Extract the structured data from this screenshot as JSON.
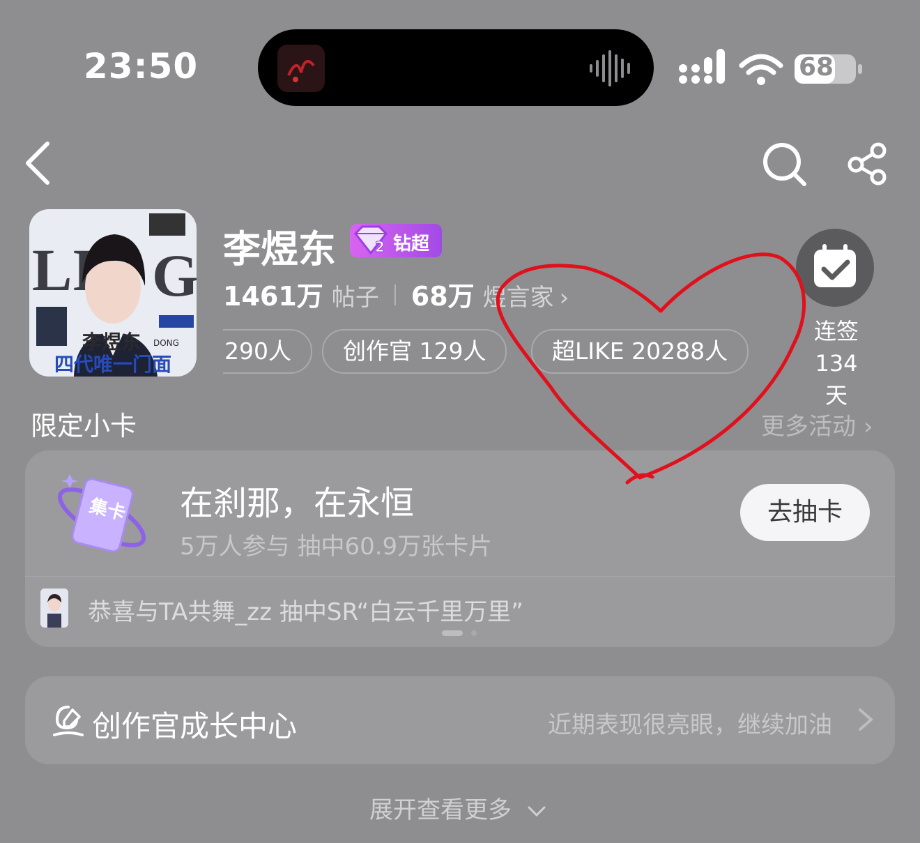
{
  "status": {
    "time": "23:50",
    "battery": "68"
  },
  "profile": {
    "name": "李煜东",
    "badge": "钻超",
    "avatar_text": {
      "name": "李煜东",
      "slogan": "四代唯一门面",
      "tag": "DONG"
    },
    "stats": [
      {
        "value": "1461万",
        "label": "帖子"
      },
      {
        "value": "68万",
        "label": "煜言家"
      }
    ],
    "pills": [
      "290人",
      "创作官 129人",
      "超LIKE 20288人"
    ],
    "checkin": {
      "line1": "连签134",
      "line2": "天"
    }
  },
  "section": {
    "title": "限定小卡",
    "more": "更多活动"
  },
  "card": {
    "icon_text": "集卡",
    "title": "在刹那，在永恒",
    "subtitle": "5万人参与 抽中60.9万张卡片",
    "button": "去抽卡",
    "news": "恭喜与TA共舞_zz 抽中SR“白云千里万里”"
  },
  "growth": {
    "title": "创作官成长中心",
    "note": "近期表现很亮眼，继续加油"
  },
  "expand": "展开查看更多",
  "colors": {
    "badge": "#c05cec",
    "annotation": "#e0101c",
    "background": "#8e8d8f"
  }
}
